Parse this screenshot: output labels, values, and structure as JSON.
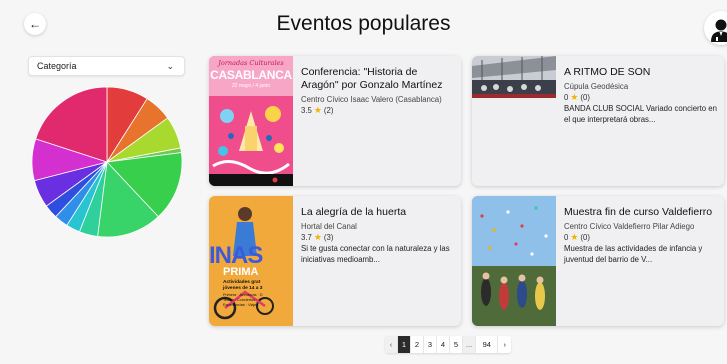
{
  "header": {
    "title": "Eventos populares",
    "back_icon": "arrow-left-icon",
    "user_icon": "user-icon"
  },
  "filter": {
    "selected": "Categoría",
    "icon": "chevron-down-icon"
  },
  "pie": {
    "slices": [
      {
        "value": 9,
        "color": "#e23c3c"
      },
      {
        "value": 6,
        "color": "#e8732d"
      },
      {
        "value": 7,
        "color": "#a8d92f"
      },
      {
        "value": 1,
        "color": "#72c850"
      },
      {
        "value": 15,
        "color": "#38cf4d"
      },
      {
        "value": 14,
        "color": "#38d46a"
      },
      {
        "value": 4,
        "color": "#2fd09c"
      },
      {
        "value": 3,
        "color": "#29c4d2"
      },
      {
        "value": 3,
        "color": "#2f8ee8"
      },
      {
        "value": 3,
        "color": "#2f4ee0"
      },
      {
        "value": 6,
        "color": "#6a2fe0"
      },
      {
        "value": 9,
        "color": "#d42fcf"
      },
      {
        "value": 20,
        "color": "#e02a6d"
      }
    ]
  },
  "events": [
    {
      "title": "Conferencia: \"Historia de Aragón\" por Gonzalo Martínez",
      "location": "Centro Cívico Isaac Valero (Casablanca)",
      "rating": "3.5",
      "count": "(2)",
      "description": "",
      "poster": {
        "line1": "Jornadas Culturales",
        "line2": "CASABLANCA",
        "line3": "22 mayo / 4 junio"
      }
    },
    {
      "title": "A RITMO DE SON",
      "location": "Cúpula Geodésica",
      "rating": "0",
      "count": "(0)",
      "description": "BANDA CLUB SOCIAL Variado concierto en el que interpretará obras..."
    },
    {
      "title": "La alegría de la huerta",
      "location": "Hortal del Canal",
      "rating": "3.7",
      "count": "(3)",
      "description": "Si te gusta conectar con la naturaleza y las iniciativas medioamb...",
      "poster": {
        "line1": "INAS",
        "line2": "PRIMA",
        "line3": "Actividades grat",
        "line4": "jóvenes de 14 a 3",
        "line5": "Primera · Aventuras · D",
        "line6": "Teatro · Conciertos · C",
        "line7": "Experiencias · Viajes"
      }
    },
    {
      "title": "Muestra fin de curso Valdefierro",
      "location": "Centro Cívico Valdefierro Pilar Adiego",
      "rating": "0",
      "count": "(0)",
      "description": "Muestra de las actividades de infancia y juventud del barrio de V..."
    }
  ],
  "pagination": {
    "prev": "‹",
    "pages": [
      "1",
      "2",
      "3",
      "4",
      "5",
      "...",
      "94"
    ],
    "next": "›",
    "active": "1"
  }
}
